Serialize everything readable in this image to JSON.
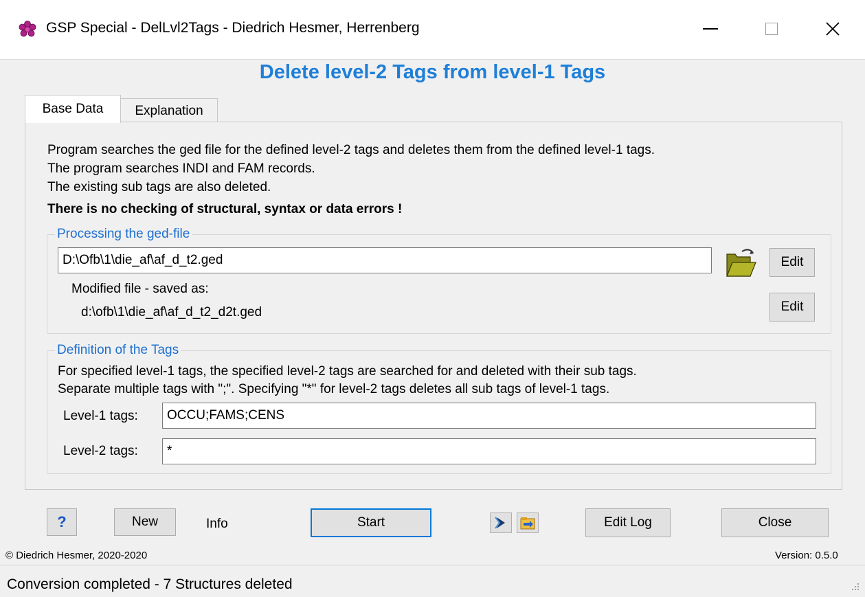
{
  "window": {
    "title": "GSP Special - DelLvl2Tags  -  Diedrich Hesmer, Herrenberg"
  },
  "header": {
    "title": "Delete level-2 Tags from level-1 Tags"
  },
  "tabs": [
    {
      "label": "Base Data",
      "active": true
    },
    {
      "label": "Explanation",
      "active": false
    }
  ],
  "description": {
    "line1": "Program searches the ged file for the defined level-2 tags and deletes them from the defined level-1 tags.",
    "line2": "The program searches INDI and FAM records.",
    "line3": "The existing sub tags are also deleted.",
    "warning": "There is no checking of structural, syntax or data errors !"
  },
  "processing": {
    "legend": "Processing the ged-file",
    "file_path": "D:\\Ofb\\1\\die_af\\af_d_t2.ged",
    "edit_label": "Edit",
    "modified_label": "Modified file - saved as:",
    "modified_path": "d:\\ofb\\1\\die_af\\af_d_t2_d2t.ged",
    "edit2_label": "Edit"
  },
  "tags": {
    "legend": "Definition of the Tags",
    "info1": "For specified level-1 tags, the specified level-2 tags are searched for and deleted with their sub tags.",
    "info2": "Separate multiple tags with \";\". Specifying \"*\" for level-2 tags deletes all sub tags of level-1 tags.",
    "level1_label": "Level-1 tags:",
    "level1_value": "OCCU;FAMS;CENS",
    "level2_label": "Level-2 tags:",
    "level2_value": "*"
  },
  "buttons": {
    "help_label": "?",
    "new_label": "New",
    "info_label": "Info",
    "start_label": "Start",
    "editlog_label": "Edit Log",
    "close_label": "Close"
  },
  "footer": {
    "copyright": "© Diedrich Hesmer,  2020-2020",
    "version": "Version: 0.5.0"
  },
  "status": {
    "text": "Conversion completed - 7 Structures deleted"
  },
  "colors": {
    "accent": "#1e7fd8",
    "legend": "#1e6fd0"
  }
}
